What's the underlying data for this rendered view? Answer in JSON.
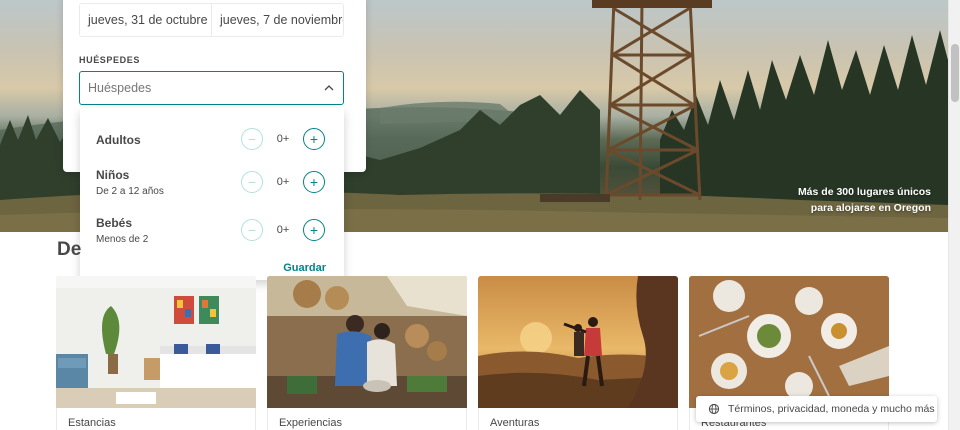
{
  "search": {
    "checkin": "jueves, 31 de octubre",
    "checkout": "jueves, 7 de noviembre",
    "guests_label": "HUÉSPEDES",
    "guests_placeholder": "Huéspedes"
  },
  "guests_dropdown": {
    "rows": [
      {
        "title": "Adultos",
        "subtitle": "",
        "count": "0+"
      },
      {
        "title": "Niños",
        "subtitle": "De 2 a 12 años",
        "count": "0+"
      },
      {
        "title": "Bebés",
        "subtitle": "Menos de 2",
        "count": "0+"
      }
    ],
    "minus_symbol": "−",
    "plus_symbol": "+",
    "save_label": "Guardar"
  },
  "hero": {
    "caption_line1": "Más de 300 lugares únicos",
    "caption_line2": "para alojarse en Oregon"
  },
  "section": {
    "title": "De"
  },
  "cards": [
    {
      "label": "Estancias"
    },
    {
      "label": "Experiencias"
    },
    {
      "label": "Aventuras"
    },
    {
      "label": "Restaurantes"
    }
  ],
  "footer": {
    "text": "Términos, privacidad, moneda y mucho más",
    "icon": "globe-icon"
  },
  "colors": {
    "accent": "#008489",
    "text": "#484848"
  }
}
